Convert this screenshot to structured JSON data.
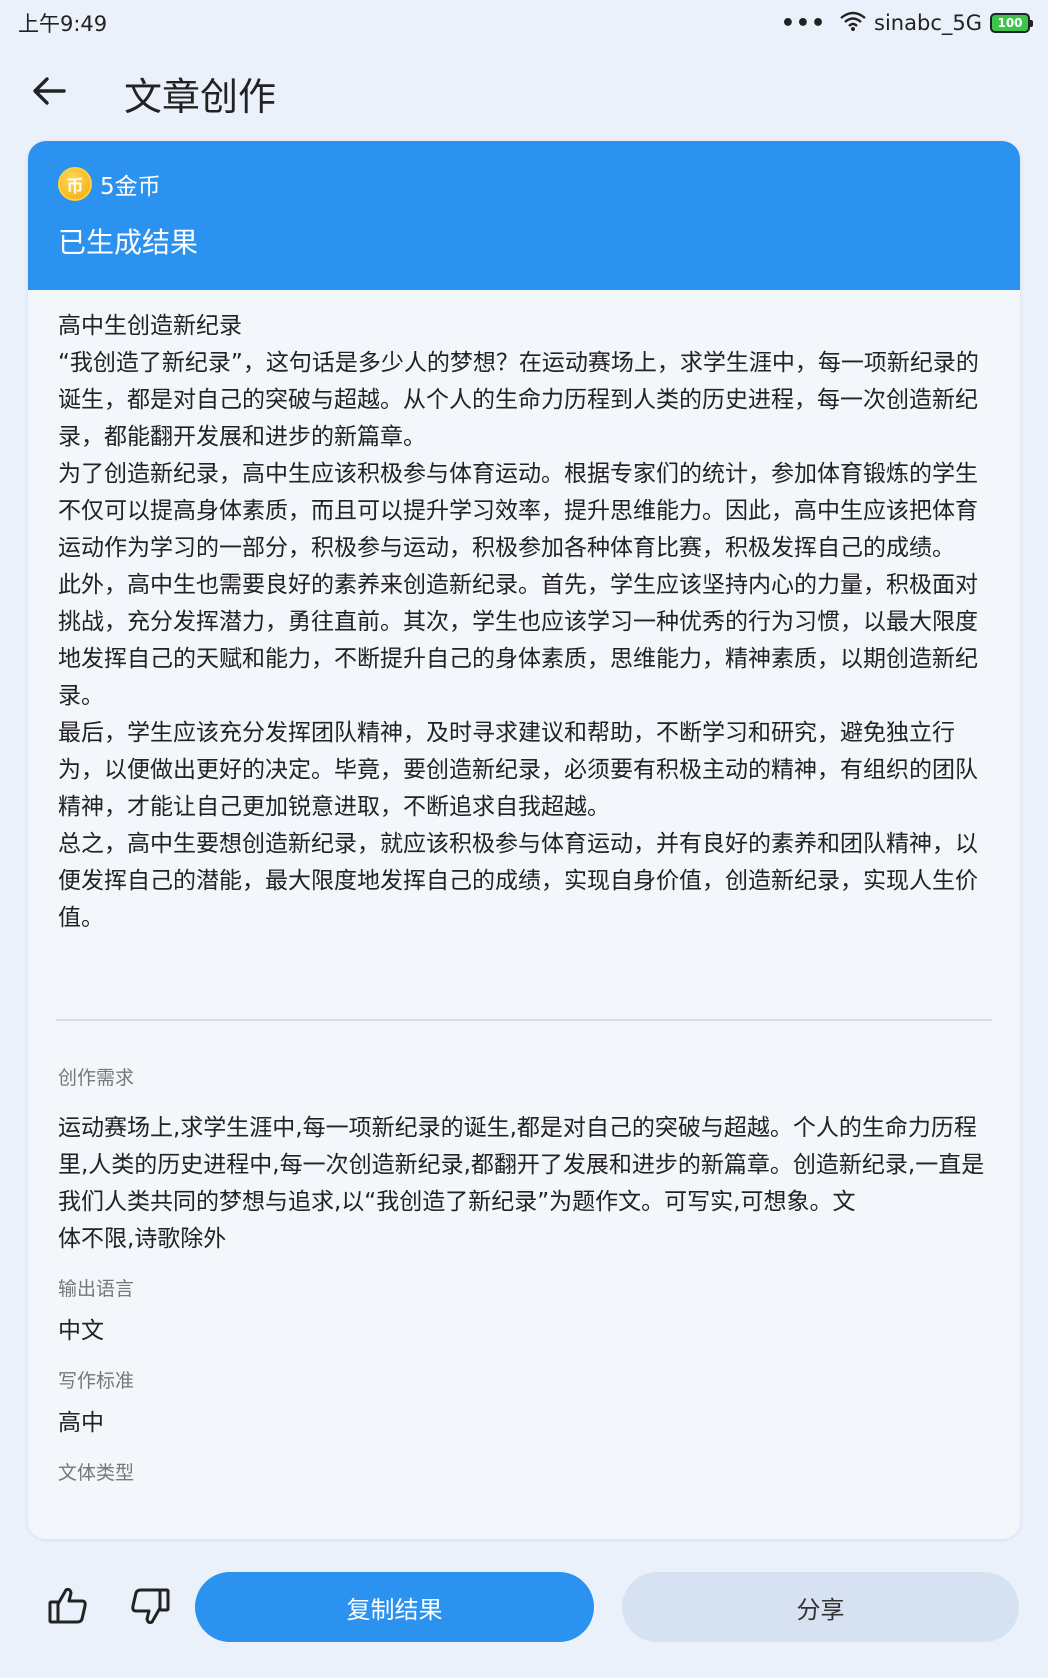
{
  "status_bar": {
    "time": "上午9:49",
    "dots": "•••",
    "wifi_icon": "wifi-icon",
    "network": "sinabc_5G",
    "battery": "100"
  },
  "app_bar": {
    "back_icon": "arrow-left-icon",
    "title": "文章创作"
  },
  "result_card": {
    "header_color": "#2b92f0",
    "coin_icon": "coin-icon",
    "coin_glyph": "币",
    "coin_text": "5金币",
    "status": "已生成结果",
    "article": [
      "高中生创造新纪录",
      "“我创造了新纪录”，这句话是多少人的梦想？在运动赛场上，求学生涯中，每一项新纪录的诞生，都是对自己的突破与超越。从个人的生命力历程到人类的历史进程，每一次创造新纪录，都能翻开发展和进步的新篇章。",
      " 为了创造新纪录，高中生应该积极参与体育运动。根据专家们的统计，参加体育锻炼的学生不仅可以提高身体素质，而且可以提升学习效率，提升思维能力。因此，高中生应该把体育运动作为学习的一部分，积极参与运动，积极参加各种体育比赛，积极发挥自己的成绩。",
      " 此外，高中生也需要良好的素养来创造新纪录。首先，学生应该坚持内心的力量，积极面对挑战，充分发挥潜力，勇往直前。其次，学生也应该学习一种优秀的行为习惯，以最大限度地发挥自己的天赋和能力，不断提升自己的身体素质，思维能力，精神素质，以期创造新纪录。",
      " 最后，学生应该充分发挥团队精神，及时寻求建议和帮助，不断学习和研究，避免独立行为，以便做出更好的决定。毕竟，要创造新纪录，必须要有积极主动的精神，有组织的团队精神，才能让自己更加锐意进取，不断追求自我超越。",
      " 总之，高中生要想创造新纪录，就应该积极参与体育运动，并有良好的素养和团队精神，以便发挥自己的潜能，最大限度地发挥自己的成绩，实现自身价值，创造新纪录，实现人生价值。"
    ],
    "requirement_label": "创作需求",
    "requirement_text": "运动赛场上,求学生涯中,每一项新纪录的诞生,都是对自己的突破与超越。个人的生命力历程里,人类的历史进程中,每一次创造新纪录,都翻开了发展和进步的新篇章。创造新纪录,一直是我们人类共同的梦想与追求,以“我创造了新纪录”为题作文。可写实,可想象。文",
    "requirement_text_2": "体不限,诗歌除外",
    "language_label": "输出语言",
    "language_value": "中文",
    "standard_label": "写作标准",
    "standard_value": "高中",
    "genre_label": "文体类型"
  },
  "bottom_bar": {
    "like_icon": "thumbs-up-icon",
    "dislike_icon": "thumbs-down-icon",
    "copy_label": "复制结果",
    "share_label": "分享"
  }
}
